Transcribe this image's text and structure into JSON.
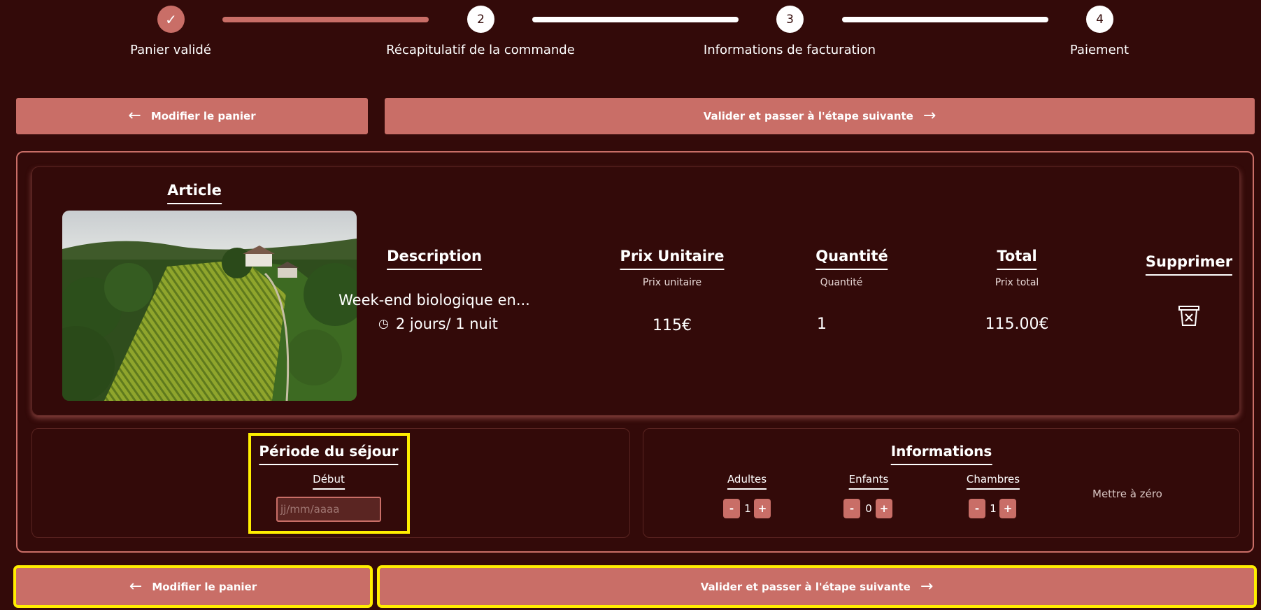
{
  "stepper": {
    "steps": [
      {
        "number": "✓",
        "label": "Panier validé"
      },
      {
        "number": "2",
        "label": "Récapitulatif de la commande"
      },
      {
        "number": "3",
        "label": "Informations de facturation"
      },
      {
        "number": "4",
        "label": "Paiement"
      }
    ]
  },
  "actions": {
    "back_label": "Modifier le panier",
    "next_label": "Valider et passer à l'étape suivante"
  },
  "article": {
    "headers": {
      "article": "Article",
      "description": "Description",
      "unit_price": "Prix Unitaire",
      "quantity": "Quantité",
      "total": "Total",
      "delete": "Supprimer"
    },
    "subheaders": {
      "unit_price": "Prix unitaire",
      "quantity": "Quantité",
      "total": "Prix total"
    },
    "title": "Week-end biologique en...",
    "duration": "2 jours/ 1 nuit",
    "unit_price": "115€",
    "quantity": "1",
    "total": "115.00€"
  },
  "stay": {
    "title": "Période du séjour",
    "start_label": "Début",
    "date_placeholder": "jj/mm/aaaa"
  },
  "info": {
    "title": "Informations",
    "adults_label": "Adultes",
    "adults": "1",
    "children_label": "Enfants",
    "children": "0",
    "rooms_label": "Chambres",
    "rooms": "1",
    "reset_label": "Mettre à zéro",
    "minus": "-",
    "plus": "+"
  },
  "colors": {
    "background": "#330a09",
    "accent": "#c96e67",
    "highlight": "#ffee00"
  }
}
